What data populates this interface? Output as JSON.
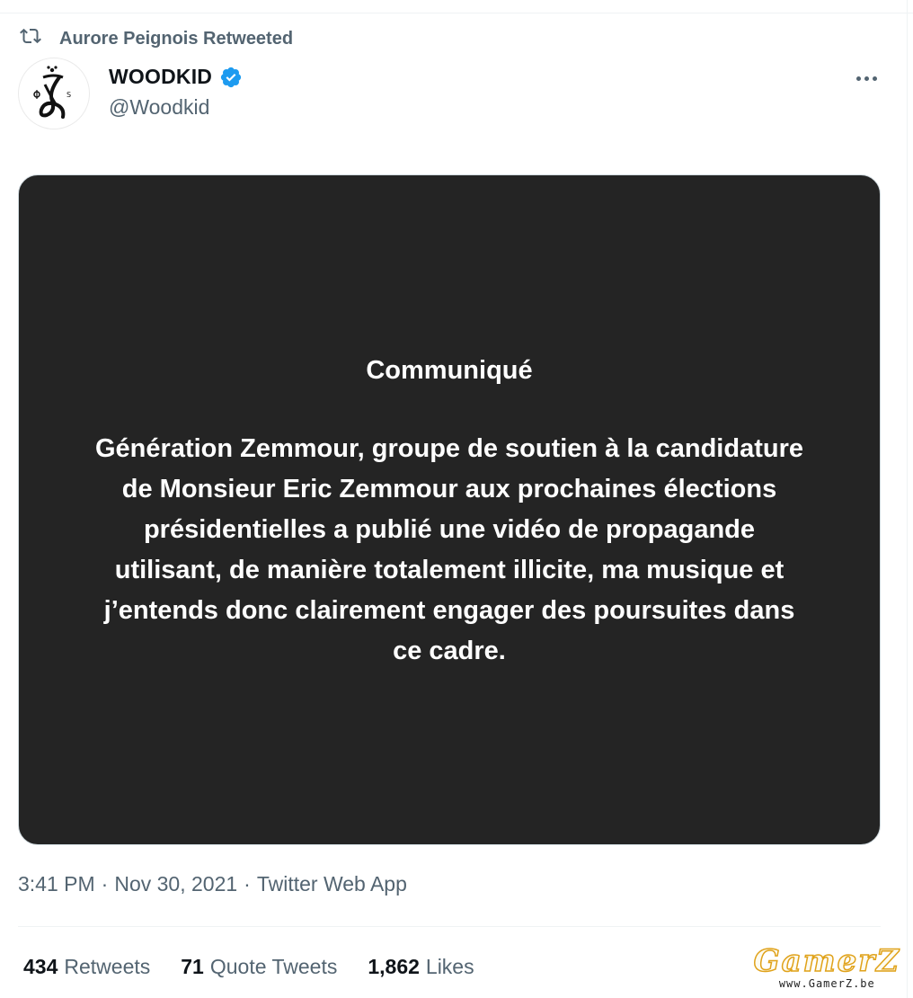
{
  "retweet": {
    "icon": "retweet-icon",
    "label": "Aurore Peignois Retweeted"
  },
  "author": {
    "display_name": "WOODKID",
    "handle": "@Woodkid",
    "verified": true,
    "verified_color": "#1d9bf0"
  },
  "media": {
    "title": "Communiqué",
    "body": "Génération Zemmour, groupe de soutien à la candidature de Monsieur Eric Zemmour aux prochaines élections présidentielles a publié une vidéo de propagande utilisant, de manière totalement illicite, ma musique et j’entends donc clairement engager des poursuites dans ce cadre.",
    "background": "#242424"
  },
  "meta": {
    "time": "3:41 PM",
    "date": "Nov 30, 2021",
    "source": "Twitter Web App",
    "separator": "·"
  },
  "stats": {
    "retweets_count": "434",
    "retweets_label": "Retweets",
    "quotes_count": "71",
    "quotes_label": "Quote Tweets",
    "likes_count": "1,862",
    "likes_label": "Likes"
  },
  "watermark": {
    "logo": "GamerZ",
    "url": "www.GamerZ.be"
  }
}
